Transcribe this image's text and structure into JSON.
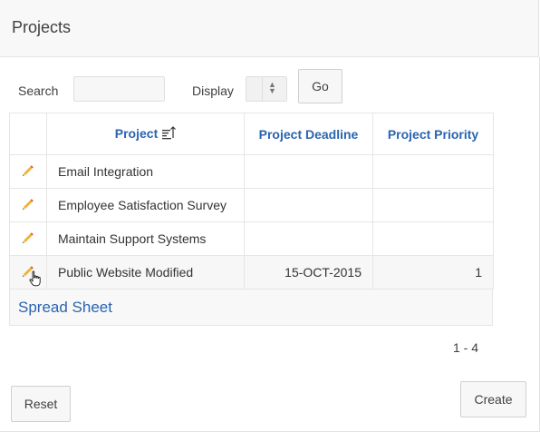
{
  "region": {
    "title": "Projects"
  },
  "search": {
    "label": "Search",
    "value": "",
    "placeholder": ""
  },
  "display": {
    "label": "Display",
    "selected": ""
  },
  "buttons": {
    "go": "Go",
    "reset": "Reset",
    "create": "Create"
  },
  "table": {
    "columns": {
      "project": "Project",
      "deadline": "Project Deadline",
      "priority": "Project Priority"
    },
    "sort": {
      "column": "project",
      "direction": "ascending"
    },
    "rows": [
      {
        "project": "Email Integration",
        "deadline": "",
        "priority": ""
      },
      {
        "project": "Employee Satisfaction Survey",
        "deadline": "",
        "priority": ""
      },
      {
        "project": "Maintain Support Systems",
        "deadline": "",
        "priority": ""
      },
      {
        "project": "Public Website Modified",
        "deadline": "15-OCT-2015",
        "priority": "1"
      }
    ]
  },
  "spreadsheet": {
    "label": "Spread Sheet"
  },
  "pagination": {
    "range": "1 - 4"
  },
  "icons": {
    "edit": "pencil-icon",
    "cursor": "hand-pointer-icon",
    "sort": "sort-ascending-icon"
  },
  "colors": {
    "link": "#2a64b0",
    "pencil_body": "#f2b233",
    "pencil_tip": "#e2562f"
  }
}
